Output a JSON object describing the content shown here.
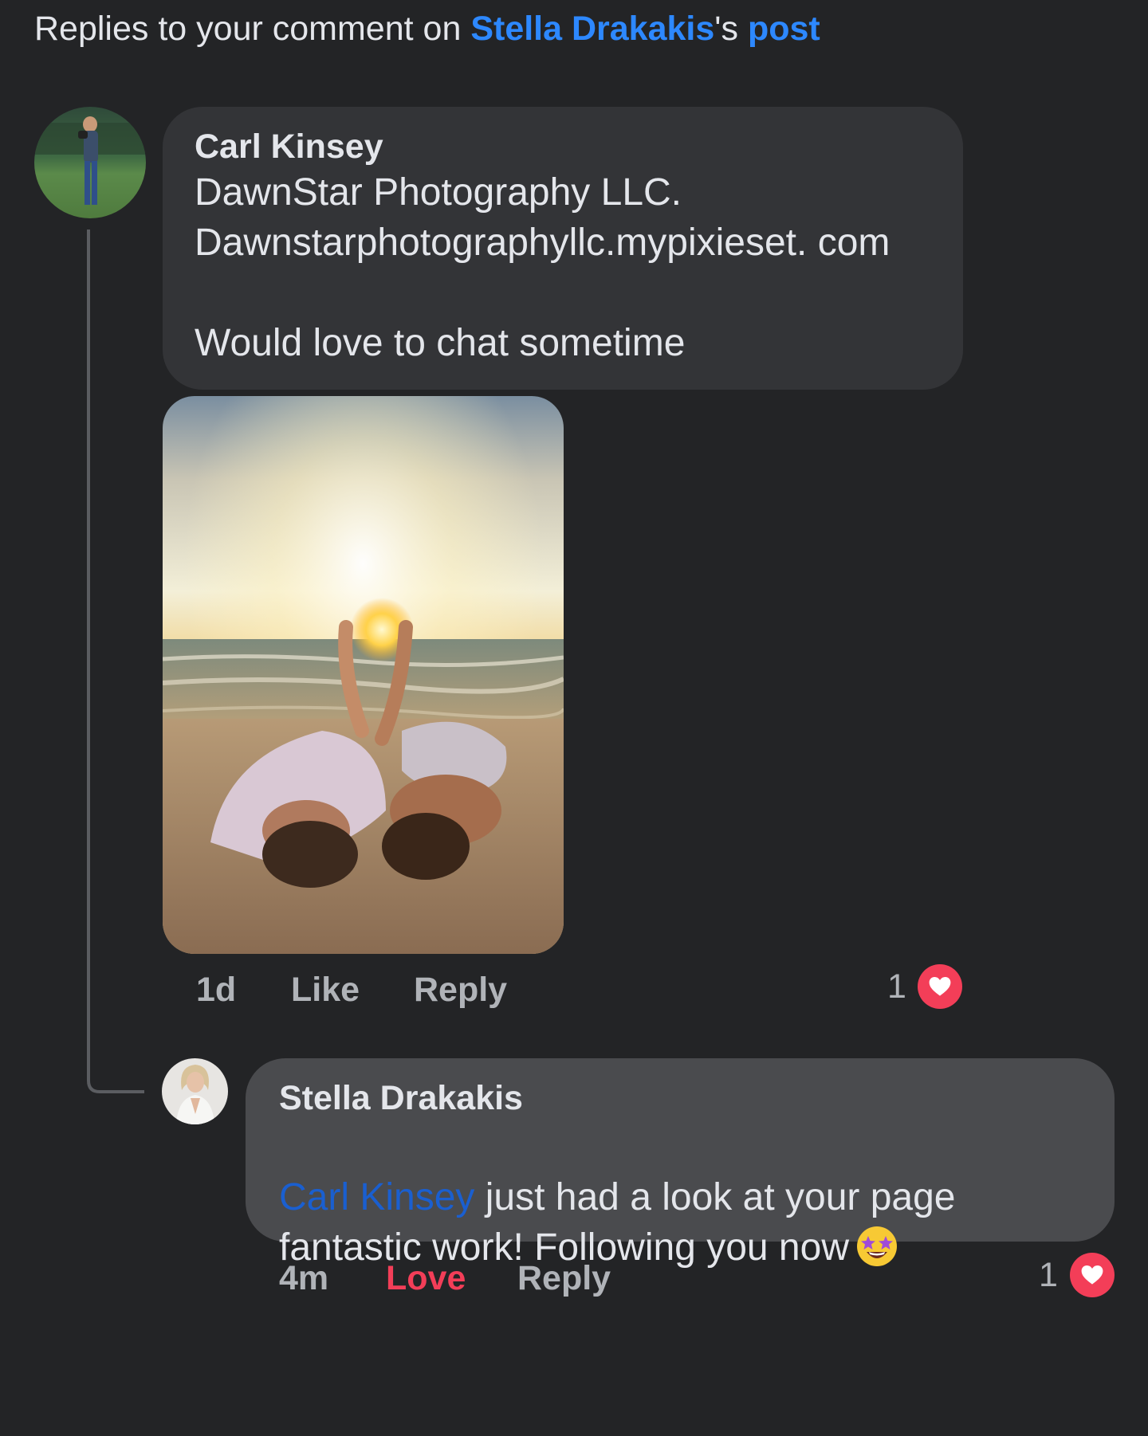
{
  "header": {
    "prefix": "Replies to your comment on ",
    "person": "Stella Drakakis",
    "possessive": "'s ",
    "post_link": "post"
  },
  "comments": [
    {
      "author": "Carl Kinsey",
      "text": "DawnStar Photography LLC.\nDawnstarphotographyllc.mypixieset. com\n\nWould love to chat sometime",
      "has_photo": true,
      "time": "1d",
      "like_label": "Like",
      "reply_label": "Reply",
      "reaction_count": "1",
      "reaction_icon": "heart-icon"
    },
    {
      "author": "Stella Drakakis",
      "mention": "Carl Kinsey",
      "text": " just had a look at your page fantastic work! Following you now",
      "emoji": "star-struck-emoji",
      "time": "4m",
      "like_label": "Love",
      "reply_label": "Reply",
      "reaction_count": "1",
      "reaction_icon": "heart-icon"
    }
  ],
  "colors": {
    "background": "#232426",
    "link_blue": "#2d88ff",
    "love_red": "#f33e58",
    "bubble_dark": "#333437",
    "bubble_light": "#4a4b4e"
  }
}
